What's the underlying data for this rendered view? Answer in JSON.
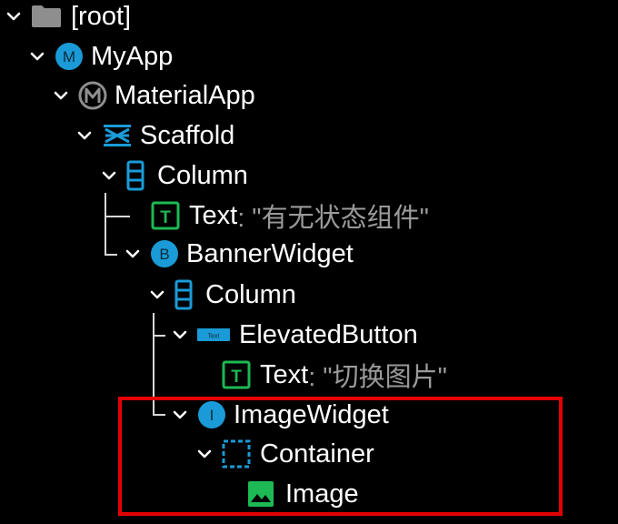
{
  "tree": {
    "nodes": [
      {
        "label": "[root]",
        "icon": "folder-icon"
      },
      {
        "label": "MyApp",
        "icon": "circle-m-icon"
      },
      {
        "label": "MaterialApp",
        "icon": "material-app-icon"
      },
      {
        "label": "Scaffold",
        "icon": "scaffold-icon"
      },
      {
        "label": "Column",
        "icon": "column-icon"
      },
      {
        "label": "Text",
        "value": ": \"有无状态组件\"",
        "icon": "text-t-icon"
      },
      {
        "label": "BannerWidget",
        "icon": "circle-b-icon"
      },
      {
        "label": "Column",
        "icon": "column-icon"
      },
      {
        "label": "ElevatedButton",
        "icon": "elevated-button-icon"
      },
      {
        "label": "Text",
        "value": ": \"切换图片\"",
        "icon": "text-t-icon"
      },
      {
        "label": "ImageWidget",
        "icon": "circle-i-icon"
      },
      {
        "label": "Container",
        "icon": "container-icon"
      },
      {
        "label": "Image",
        "icon": "image-icon"
      }
    ],
    "icon_letters": {
      "myapp": "M",
      "banner": "B",
      "imagewidget": "I",
      "text": "T",
      "button": "Text"
    }
  },
  "colors": {
    "accent_blue": "#1a9bd7",
    "accent_green": "#1db954",
    "highlight_red": "#e50000",
    "muted_text": "#9a9a9a"
  }
}
